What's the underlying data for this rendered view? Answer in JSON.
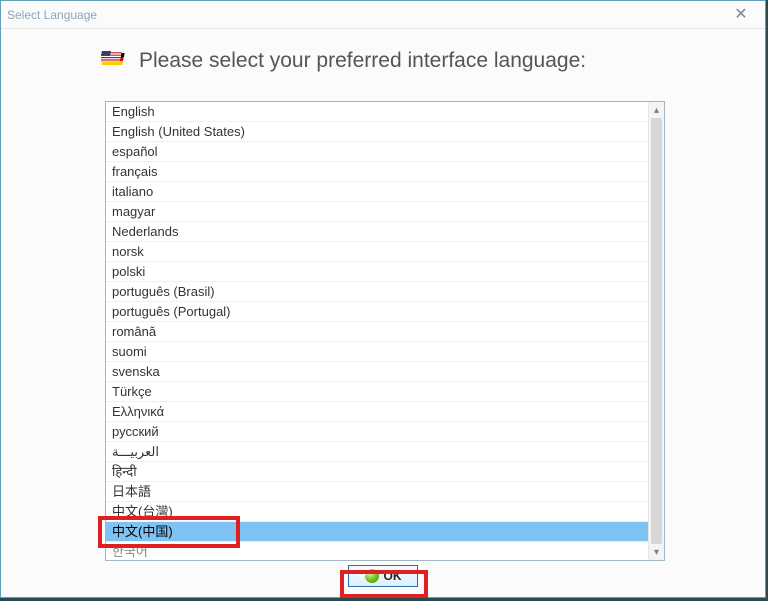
{
  "window": {
    "title": "Select Language"
  },
  "header": {
    "text": "Please select your preferred interface language:"
  },
  "languages": [
    "English",
    "English (United States)",
    "español",
    "français",
    "italiano",
    "magyar",
    "Nederlands",
    "norsk",
    "polski",
    "português (Brasil)",
    "português (Portugal)",
    "română",
    "suomi",
    "svenska",
    "Türkçe",
    "Ελληνικά",
    "русский",
    "العربيـــة",
    "हिन्दी",
    "日本語",
    "中文(台灣)",
    "中文(中国)",
    "한국어"
  ],
  "selected_index": 21,
  "buttons": {
    "ok": "OK"
  }
}
